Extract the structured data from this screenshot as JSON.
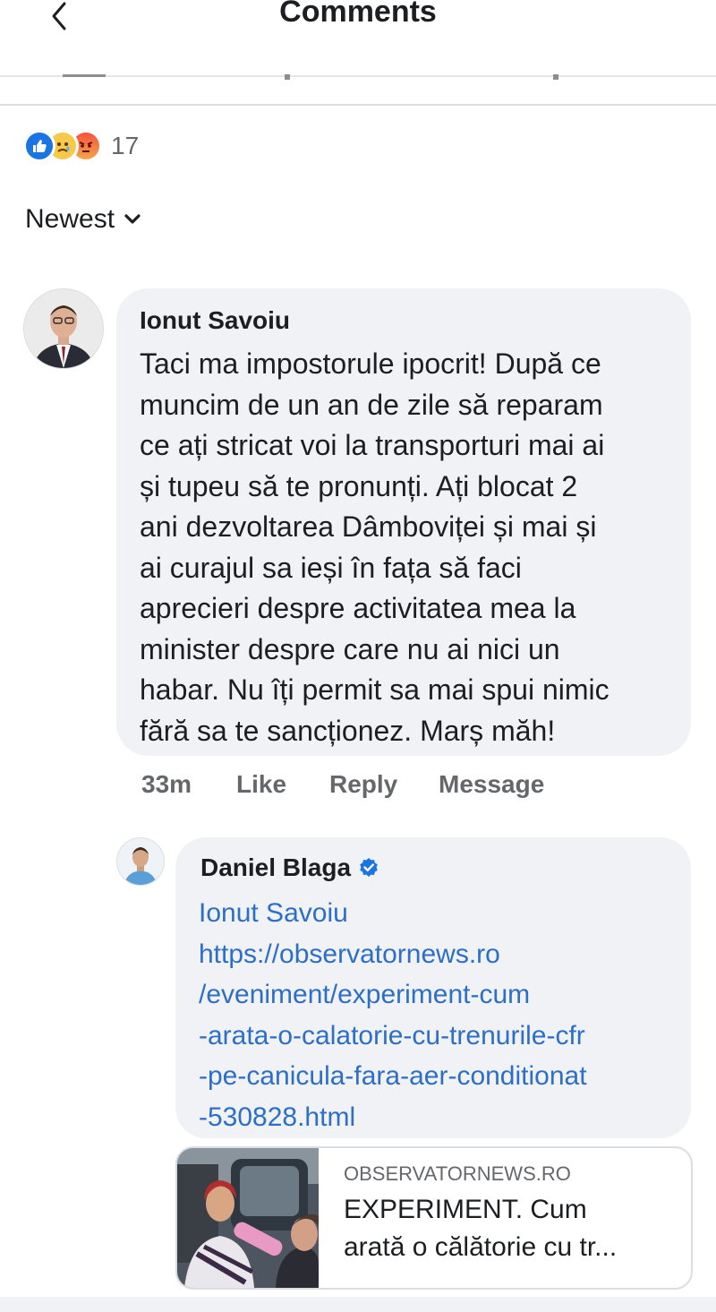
{
  "header": {
    "title": "Comments"
  },
  "reactions": {
    "count": "17",
    "types": [
      "like",
      "sad",
      "angry"
    ]
  },
  "sort": {
    "label": "Newest"
  },
  "comment": {
    "author": "Ionut Savoiu",
    "lines": [
      "Taci ma impostorule ipocrit! După ce",
      "muncim de un an de zile să reparam",
      "ce ați stricat voi la transporturi mai ai",
      "și tupeu să te pronunți. Ați blocat 2",
      "ani dezvoltarea Dâmboviței și mai și",
      "ai curajul sa ieși în fața să faci",
      "aprecieri despre activitatea mea la",
      "minister despre care nu ai nici un",
      "habar. Nu îți permit sa mai spui nimic",
      "fără sa te sancționez. Marș măh!"
    ],
    "time": "33m",
    "like_label": "Like",
    "reply_label": "Reply",
    "message_label": "Message"
  },
  "reply": {
    "author": "Daniel Blaga",
    "verified": true,
    "mention": "Ionut Savoiu",
    "link_lines": [
      "https://observatornews.ro",
      "/eveniment/experiment-cum",
      "-arata-o-calatorie-cu-trenurile-cfr",
      "-pe-canicula-fara-aer-conditionat",
      "-530828.html"
    ]
  },
  "link_preview": {
    "domain": "OBSERVATORNEWS.RO",
    "title_lines": [
      "EXPERIMENT. Cum",
      "arată o călătorie cu tr..."
    ]
  },
  "colors": {
    "link": "#2d6ec6",
    "bubble": "#f0f2f5",
    "muted": "#65676b",
    "verified": "#1b74e4"
  }
}
